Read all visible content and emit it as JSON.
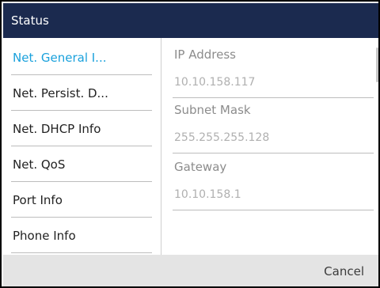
{
  "header": {
    "title": "Status"
  },
  "sidebar": {
    "selected_index": 0,
    "items": [
      {
        "label": "Net. General I..."
      },
      {
        "label": "Net. Persist. D..."
      },
      {
        "label": "Net. DHCP Info"
      },
      {
        "label": "Net. QoS"
      },
      {
        "label": "Port Info"
      },
      {
        "label": "Phone Info"
      }
    ]
  },
  "detail": {
    "fields": [
      {
        "label": "IP Address",
        "value": "10.10.158.117"
      },
      {
        "label": "Subnet Mask",
        "value": "255.255.255.128"
      },
      {
        "label": "Gateway",
        "value": "10.10.158.1"
      }
    ]
  },
  "footer": {
    "cancel_label": "Cancel"
  },
  "colors": {
    "title_bar": "#1b2a4f",
    "selected_text": "#1aa1dc",
    "footer_bg": "#e4e4e4"
  }
}
